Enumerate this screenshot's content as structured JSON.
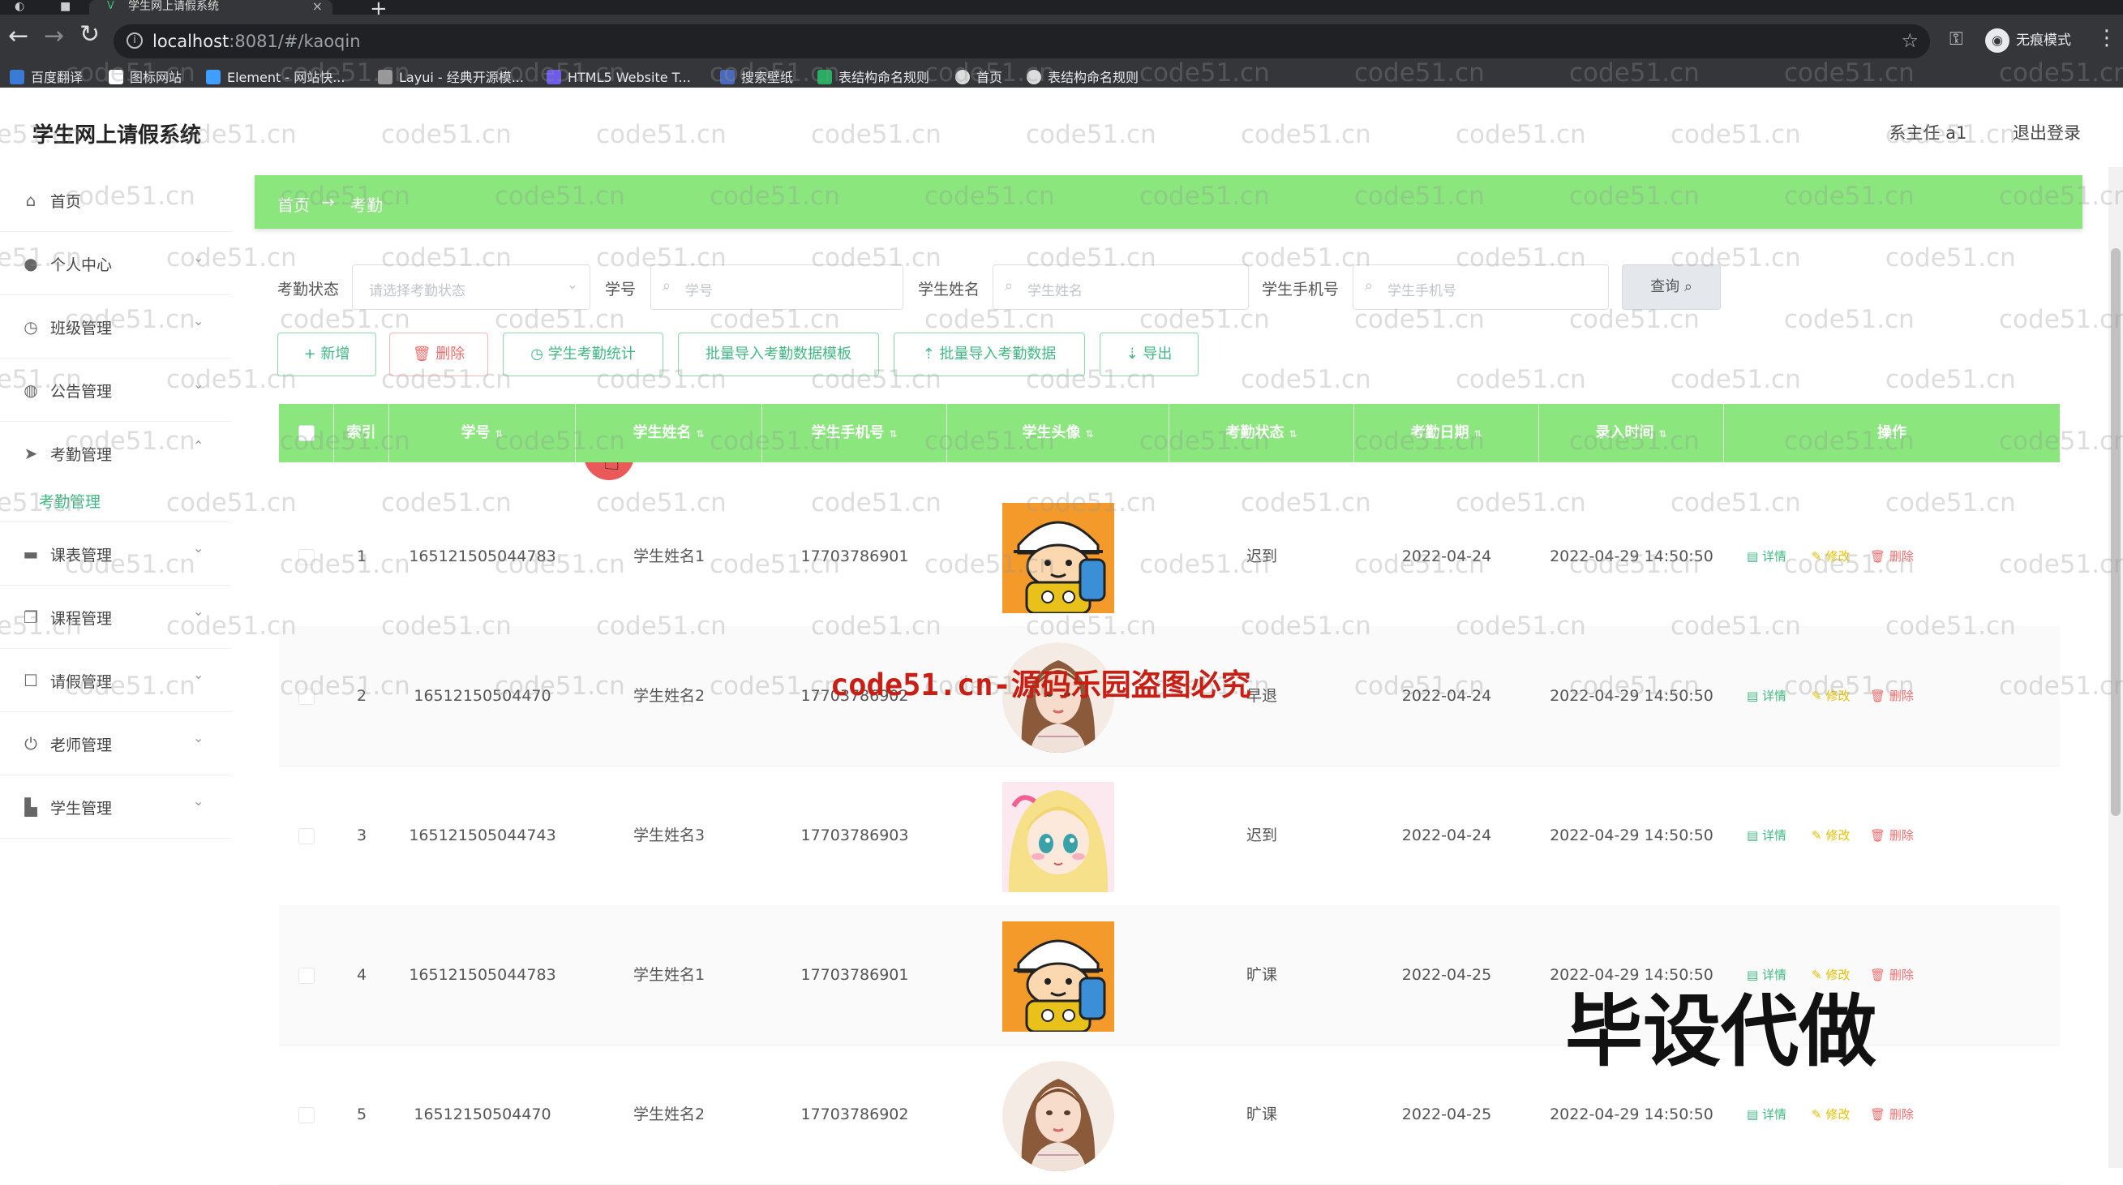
{
  "browser": {
    "tab_title": "学生网上请假系统",
    "url_host": "localhost",
    "url_rest": ":8081/#/kaoqin",
    "incognito_label": "无痕模式",
    "bookmarks": [
      "百度翻译",
      "图标网站",
      "Element - 网站快...",
      "Layui - 经典开源模...",
      "HTML5 Website T...",
      "搜索壁纸",
      "表结构命名规则",
      "首页",
      "表结构命名规则"
    ]
  },
  "app": {
    "title": "学生网上请假系统",
    "user": "系主任 a1",
    "logout": "退出登录"
  },
  "sidebar": {
    "items": [
      {
        "label": "首页",
        "icon": "home-icon"
      },
      {
        "label": "个人中心",
        "icon": "user-icon"
      },
      {
        "label": "班级管理",
        "icon": "clock-icon"
      },
      {
        "label": "公告管理",
        "icon": "globe-icon"
      },
      {
        "label": "考勤管理",
        "icon": "send-icon"
      },
      {
        "label": "课表管理",
        "icon": "briefcase-icon"
      },
      {
        "label": "课程管理",
        "icon": "copy-icon"
      },
      {
        "label": "请假管理",
        "icon": "square-icon"
      },
      {
        "label": "老师管理",
        "icon": "power-icon"
      },
      {
        "label": "学生管理",
        "icon": "bar-icon"
      }
    ],
    "active_sub": "考勤管理"
  },
  "breadcrumb": {
    "home": "首页",
    "sep": "→",
    "current": "考勤"
  },
  "filters": {
    "status_label": "考勤状态",
    "status_placeholder": "请选择考勤状态",
    "id_label": "学号",
    "id_placeholder": "学号",
    "name_label": "学生姓名",
    "name_placeholder": "学生姓名",
    "phone_label": "学生手机号",
    "phone_placeholder": "学生手机号",
    "query": "查询"
  },
  "actions": {
    "add": "+ 新增",
    "delete": "删除",
    "stats": "学生考勤统计",
    "import_template": "批量导入考勤数据模板",
    "import_data": "批量导入考勤数据",
    "export": "导出"
  },
  "table": {
    "headers": [
      "索引",
      "学号",
      "学生姓名",
      "学生手机号",
      "学生头像",
      "考勤状态",
      "考勤日期",
      "录入时间",
      "操作"
    ],
    "op_detail": "详情",
    "op_edit": "修改",
    "op_delete": "删除",
    "rows": [
      {
        "index": "1",
        "student_id": "165121505044783",
        "name": "学生姓名1",
        "phone": "17703786901",
        "avatar": "cartoon-boy",
        "status": "迟到",
        "date": "2022-04-24",
        "created": "2022-04-29 14:50:50"
      },
      {
        "index": "2",
        "student_id": "16512150504470",
        "name": "学生姓名2",
        "phone": "17703786902",
        "avatar": "girl-portrait",
        "status": "早退",
        "date": "2022-04-24",
        "created": "2022-04-29 14:50:50"
      },
      {
        "index": "3",
        "student_id": "165121505044743",
        "name": "学生姓名3",
        "phone": "17703786903",
        "avatar": "anime-girl",
        "status": "迟到",
        "date": "2022-04-24",
        "created": "2022-04-29 14:50:50"
      },
      {
        "index": "4",
        "student_id": "165121505044783",
        "name": "学生姓名1",
        "phone": "17703786901",
        "avatar": "cartoon-boy",
        "status": "旷课",
        "date": "2022-04-25",
        "created": "2022-04-29 14:50:50"
      },
      {
        "index": "5",
        "student_id": "16512150504470",
        "name": "学生姓名2",
        "phone": "17703786902",
        "avatar": "girl-portrait",
        "status": "旷课",
        "date": "2022-04-25",
        "created": "2022-04-29 14:50:50"
      }
    ]
  },
  "watermarks": {
    "repeat_text": "code51.cn",
    "red_text": "code51.cn-源码乐园盗图必究",
    "big_text": "毕设代做"
  }
}
